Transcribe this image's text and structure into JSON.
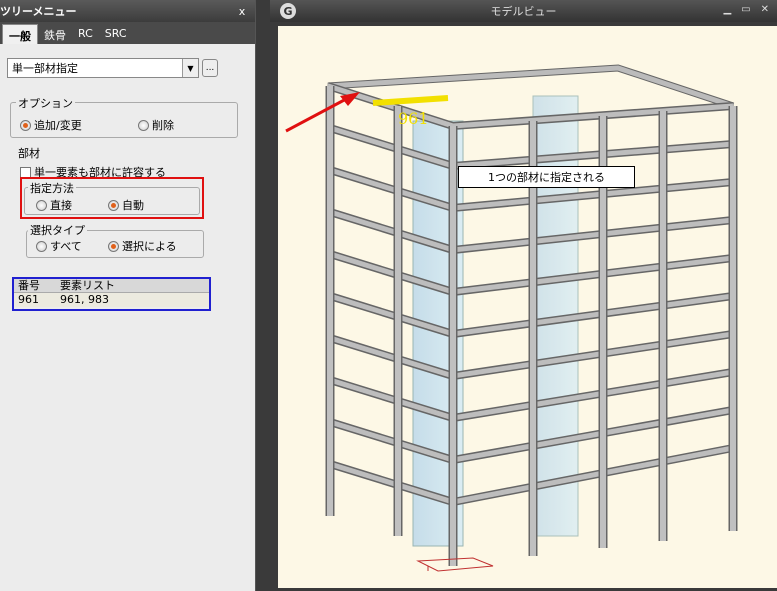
{
  "tree": {
    "title": "ツリーメニュー",
    "close": "x",
    "tabs": [
      "一般",
      "鉄骨",
      "RC",
      "SRC"
    ],
    "combo_value": "単一部材指定",
    "ellipsis": "...",
    "option_group": "オプション",
    "option_add": "追加/変更",
    "option_delete": "削除",
    "member_group": "部材",
    "allow_single": "単一要素も部材に許容する",
    "method_group": "指定方法",
    "method_direct": "直接",
    "method_auto": "自動",
    "select_group": "選択タイプ",
    "select_all": "すべて",
    "select_by": "選択による",
    "table_headers": [
      "番号",
      "要素リスト"
    ],
    "table_rows": [
      [
        "961",
        "961, 983"
      ]
    ]
  },
  "model": {
    "title": "モデルビュー",
    "label_961": "961",
    "callout": "1つの部材に指定される"
  }
}
